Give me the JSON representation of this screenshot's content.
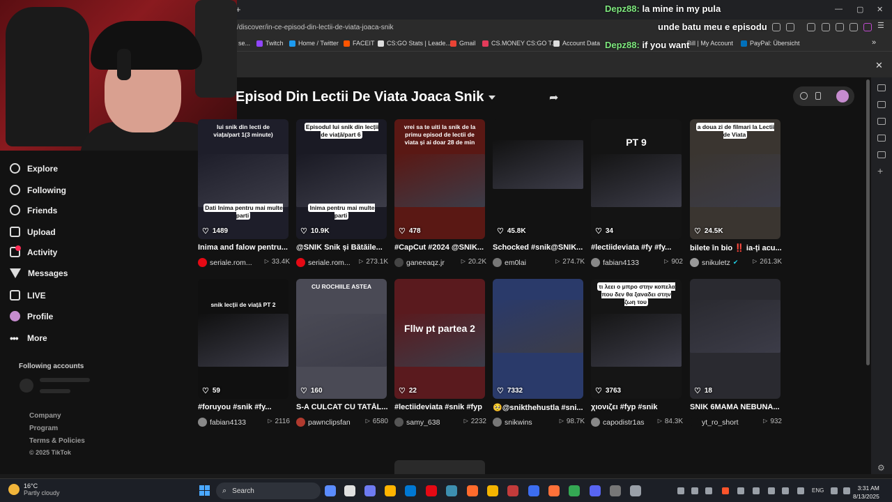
{
  "browser": {
    "url": "/discover/in-ce-episod-din-lectii-de-viata-joaca-snik",
    "new_tab": "+",
    "bookmarks": [
      {
        "label": "se...",
        "color": "#888888"
      },
      {
        "label": "Twitch",
        "color": "#9146ff"
      },
      {
        "label": "Home / Twitter",
        "color": "#1d9bf0"
      },
      {
        "label": "FACEIT",
        "color": "#ff5500"
      },
      {
        "label": "CS:GO Stats | Leade...",
        "color": "#dddddd"
      },
      {
        "label": "Gmail",
        "color": "#ea4335"
      },
      {
        "label": "CS.MONEY CS:GO T...",
        "color": "#e33b5a"
      },
      {
        "label": "Account Data",
        "color": "#dddddd"
      },
      {
        "label": "Bill | My Account",
        "color": "#888888"
      },
      {
        "label": "PayPal: Übersicht",
        "color": "#0070ba"
      }
    ],
    "window_controls": [
      "—",
      "▢",
      "✕"
    ],
    "overflow": "»",
    "overlay_close": "✕"
  },
  "chat": [
    {
      "user": "Depz88:",
      "message": "la mine in my pula"
    },
    {
      "user": "",
      "message": "unde batu meu e episodu"
    },
    {
      "user": "Depz88:",
      "message": "if you want"
    }
  ],
  "sidebar": {
    "nav": [
      {
        "label": "Explore",
        "icon": "compass-icon",
        "shape": "circle"
      },
      {
        "label": "Following",
        "icon": "user-icon",
        "shape": "circle"
      },
      {
        "label": "Friends",
        "icon": "users-icon",
        "shape": "circle"
      },
      {
        "label": "Upload",
        "icon": "plus-square-icon",
        "shape": "square"
      },
      {
        "label": "Activity",
        "icon": "inbox-icon",
        "shape": "square",
        "badge": true
      },
      {
        "label": "Messages",
        "icon": "send-icon",
        "shape": "tri"
      },
      {
        "label": "LIVE",
        "icon": "live-icon",
        "shape": "square"
      },
      {
        "label": "Profile",
        "icon": "avatar",
        "shape": "avatar"
      },
      {
        "label": "More",
        "icon": "more-icon",
        "shape": "more"
      }
    ],
    "following_header": "Following accounts",
    "footer": [
      "Company",
      "Program",
      "Terms & Policies",
      "© 2025 TikTok"
    ]
  },
  "main": {
    "title": "Episod Din Lectii De Viata Joaca Snik",
    "share_icon": "share-icon",
    "videos": [
      {
        "likes": "1489",
        "title": "Inima and falow pentru...",
        "author": "seriale.rom...",
        "views": "33.4K",
        "bg": "#1e1e2a",
        "avatar": "#e50914",
        "overlay": "lui snik din lecti de viața/part 1(3 minute)",
        "overlay2": "Dati Inima pentru mai multe parti"
      },
      {
        "likes": "10.9K",
        "title": "@SNIK Snik și Bătăile...",
        "author": "seriale.rom...",
        "views": "273.1K",
        "bg": "#1a1a24",
        "avatar": "#e50914",
        "overlay": "Episodul lui snik din lecții de viață/part 6",
        "overlay2": "Inima pentru mai multe parti"
      },
      {
        "likes": "478",
        "title": "#CapCut #2024 @SNIK...",
        "author": "ganeeaqz.jr",
        "views": "20.2K",
        "bg": "#5a1814",
        "avatar": "#444444",
        "overlay": "vrei sa te uiti la snik de la primu episod de lectii de viata și ai doar 28 de min",
        "overlay2": ""
      },
      {
        "likes": "45.8K",
        "title": "Schocked #snik@SNIK...",
        "author": "em0lai",
        "views": "274.7K",
        "bg": "#121212",
        "avatar": "#777777",
        "overlay": "",
        "overlay2": ""
      },
      {
        "likes": "34",
        "title": "#lectiideviata #fy #fy...",
        "author": "fabian4133",
        "views": "902",
        "bg": "#141414",
        "avatar": "#888888",
        "overlay": "PT 9",
        "overlay2": ""
      },
      {
        "likes": "24.5K",
        "title": "bilete în bio ‼️ ia-ți acu...",
        "author": "snikuletz",
        "views": "261.3K",
        "bg": "#3a3530",
        "avatar": "#999999",
        "overlay": "a doua zi de filmari la Lectii de Viata",
        "overlay2": "",
        "verified": "✔"
      },
      {
        "likes": "59",
        "title": "#foruyou #snik #fy...",
        "author": "fabian4133",
        "views": "2116",
        "bg": "#101010",
        "avatar": "#888888",
        "overlay": "snik lecții de viață PT 2",
        "overlay2": ""
      },
      {
        "likes": "160",
        "title": "S-A CULCAT CU TATĂL...",
        "author": "pawnclipsfan",
        "views": "6580",
        "bg": "#4a4a55",
        "avatar": "#b03a2e",
        "overlay": "CU ROCHIILE ASTEA",
        "overlay2": ""
      },
      {
        "likes": "22",
        "title": "#lectiideviata #snik #fyp",
        "author": "samy_638",
        "views": "2232",
        "bg": "#5a1a1e",
        "avatar": "#555555",
        "overlay": "Fllw pt partea 2",
        "overlay2": ""
      },
      {
        "likes": "7332",
        "title": "🥺@snikthehustla #sni...",
        "author": "snikwins",
        "views": "98.7K",
        "bg": "#2a3a6a",
        "avatar": "#777777",
        "overlay": "",
        "overlay2": ""
      },
      {
        "likes": "3763",
        "title": "χιονιζει #fyp #snik",
        "author": "capodistr1as",
        "views": "84.3K",
        "bg": "#151515",
        "avatar": "#888888",
        "overlay": "τι λεει ο μπρο στην κοπελα που δεν θα ξαναδει στην ζωη του",
        "overlay2": ""
      },
      {
        "likes": "18",
        "title": "SNIK 6MAMA NEBUNA...",
        "author": "yt_ro_short",
        "views": "932",
        "bg": "#2a2a30",
        "avatar": "#121212",
        "overlay": "",
        "overlay2": ""
      }
    ]
  },
  "taskbar": {
    "weather_temp": "16°C",
    "weather_desc": "Partly cloudy",
    "search_label": "Search",
    "lang": "ENG",
    "time": "3:31 AM",
    "date": "8/13/2025",
    "apps": [
      "#5b8cff",
      "#e0e0e0",
      "#6e7bf2",
      "#ffb400",
      "#0078d4",
      "#e50914",
      "#3d8fb0",
      "#ff6b2c",
      "#f4b400",
      "#c23b3b",
      "#3c6df0",
      "#ff7139",
      "#34a853",
      "#5865f2",
      "#777777",
      "#9aa0a8"
    ]
  }
}
